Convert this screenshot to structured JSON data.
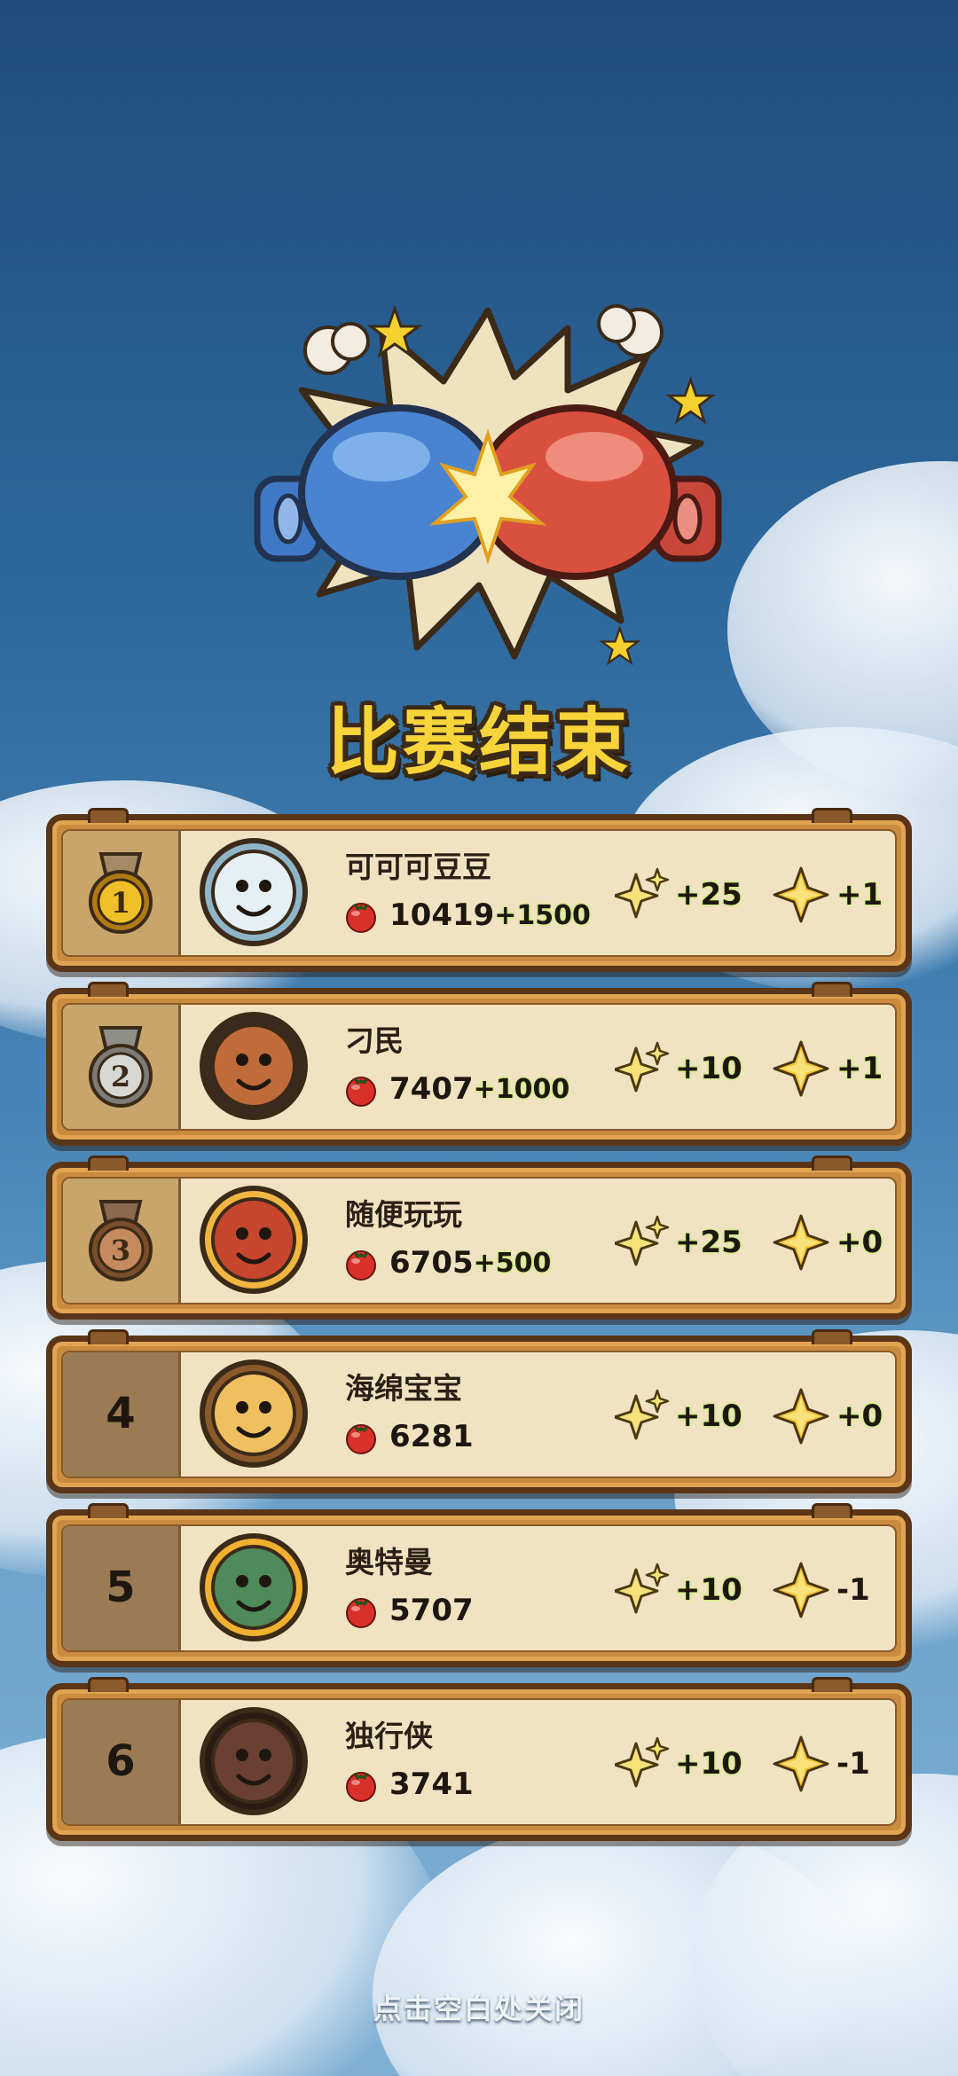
{
  "title": "比赛结束",
  "close_hint": "点击空白处关闭",
  "icons": {
    "emblem": "boxing-gloves-clash-icon",
    "score": "tomato-icon",
    "reward_a": "sparkle-stars-icon",
    "reward_b": "gold-diamond-star-icon"
  },
  "colors": {
    "title": "#f7d43a",
    "card_bg": "#f1e3c2",
    "frame": "#c98b3e",
    "bonus_glow": "#b7f05a"
  },
  "results": [
    {
      "rank": "1",
      "medal": "gold",
      "name": "可可可豆豆",
      "score": "10419",
      "bonus": "+1500",
      "reward_a": "+25",
      "reward_b": "+1"
    },
    {
      "rank": "2",
      "medal": "silver",
      "name": "刁民",
      "score": "7407",
      "bonus": "+1000",
      "reward_a": "+10",
      "reward_b": "+1"
    },
    {
      "rank": "3",
      "medal": "bronze",
      "name": "随便玩玩",
      "score": "6705",
      "bonus": "+500",
      "reward_a": "+25",
      "reward_b": "+0"
    },
    {
      "rank": "4",
      "medal": "",
      "name": "海绵宝宝",
      "score": "6281",
      "bonus": "",
      "reward_a": "+10",
      "reward_b": "+0"
    },
    {
      "rank": "5",
      "medal": "",
      "name": "奥特曼",
      "score": "5707",
      "bonus": "",
      "reward_a": "+10",
      "reward_b": "-1"
    },
    {
      "rank": "6",
      "medal": "",
      "name": "独行侠",
      "score": "3741",
      "bonus": "",
      "reward_a": "+10",
      "reward_b": "-1"
    }
  ]
}
